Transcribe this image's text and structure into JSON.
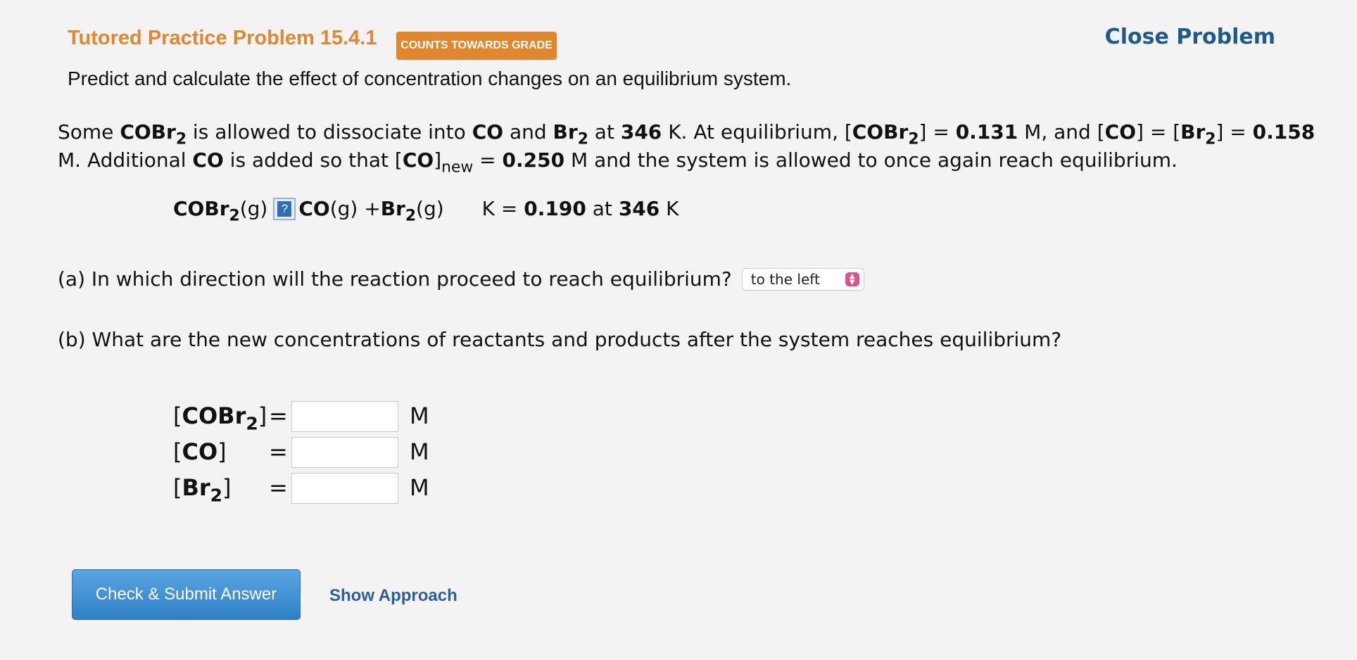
{
  "header": {
    "title": "Tutored Practice Problem 15.4.1",
    "badge": "COUNTS TOWARDS GRADE",
    "close_link": "Close Problem",
    "subtitle": "Predict and calculate the effect of concentration changes on an equilibrium system."
  },
  "problem": {
    "l1_a": "Some ",
    "l1_b": "COBr",
    "l1_b_sub": "2",
    "l1_c": " is allowed to dissociate into ",
    "l1_d": "CO",
    "l1_e": " and ",
    "l1_f": "Br",
    "l1_f_sub": "2",
    "l1_g": " at ",
    "l1_h": "346",
    "l1_i": " K. At equilibrium, [",
    "l1_j": "COBr",
    "l1_j_sub": "2",
    "l1_k": "] = ",
    "l1_l": "0.131",
    "l1_m": " M, and [",
    "l1_n": "CO",
    "l1_o": "] = [",
    "l1_p": "Br",
    "l1_p_sub": "2",
    "l1_q": "] = ",
    "l1_r": "0.158",
    "l2_a": "M. Additional ",
    "l2_b": "CO",
    "l2_c": " is added so that [",
    "l2_d": "CO",
    "l2_e": "]",
    "l2_e_sub": "new",
    "l2_f": " = ",
    "l2_g": "0.250",
    "l2_h": " M and the system is allowed to once again reach equilibrium."
  },
  "reaction": {
    "reactant": "COBr",
    "reactant_sub": "2",
    "reactant_state": "(g)",
    "arrow_icon_text": "?",
    "p1": "CO",
    "p1_state": "(g) + ",
    "p2": "Br",
    "p2_sub": "2",
    "p2_state": "(g)",
    "k_label": "K = ",
    "k_value": "0.190",
    "k_at": " at ",
    "k_temp": "346",
    "k_unit": " K"
  },
  "question_a": {
    "text": "(a) In which direction will the reaction proceed to reach equilibrium?",
    "selected": "to the left"
  },
  "question_b": {
    "text": "(b) What are the new concentrations of reactants and products after the system reaches equilibrium?"
  },
  "inputs": [
    {
      "label_open": "[",
      "label_species": "COBr",
      "label_sub": "2",
      "label_close": "]",
      "eq": "=",
      "value": "",
      "unit": "M"
    },
    {
      "label_open": "[",
      "label_species": "CO",
      "label_sub": "",
      "label_close": "]",
      "eq": "=",
      "value": "",
      "unit": "M"
    },
    {
      "label_open": "[",
      "label_species": "Br",
      "label_sub": "2",
      "label_close": "]",
      "eq": "=",
      "value": "",
      "unit": "M"
    }
  ],
  "actions": {
    "submit": "Check & Submit Answer",
    "approach": "Show Approach"
  },
  "colors": {
    "title": "#e0872f",
    "badge_bg": "#e3872f",
    "link": "#1f5a8a",
    "button": "#3a8bd0",
    "select_chevron": "#e0508f"
  }
}
